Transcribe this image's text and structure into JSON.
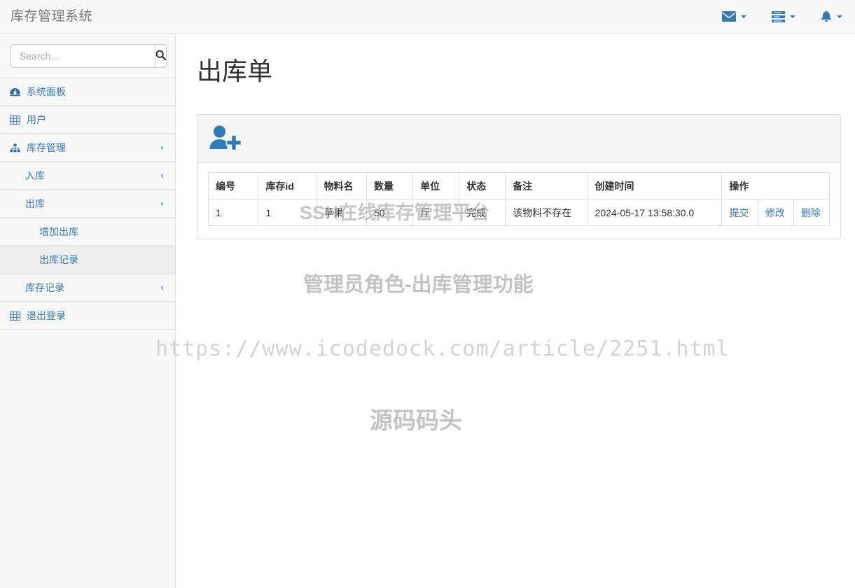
{
  "topbar": {
    "brand": "库存管理系统",
    "items": [
      {
        "icon": "envelope-icon",
        "name": "messages-dropdown"
      },
      {
        "icon": "tasks-icon",
        "name": "tasks-dropdown"
      },
      {
        "icon": "bell-icon",
        "name": "alerts-dropdown"
      }
    ],
    "accent_color": "#337ab7"
  },
  "sidebar": {
    "search": {
      "placeholder": "Search...",
      "value": "",
      "button_icon": "search-icon"
    },
    "items": [
      {
        "label": "系统面板",
        "icon": "dashboard-icon",
        "level": 1,
        "chevron": "",
        "active": false
      },
      {
        "label": "用户",
        "icon": "table-icon",
        "level": 1,
        "chevron": "",
        "active": false
      },
      {
        "label": "库存管理",
        "icon": "sitemap-icon",
        "level": 1,
        "chevron": "‹",
        "active": false
      },
      {
        "label": "入库",
        "icon": "",
        "level": 2,
        "chevron": "‹",
        "active": false
      },
      {
        "label": "出库",
        "icon": "",
        "level": 2,
        "chevron": "‹",
        "active": false
      },
      {
        "label": "增加出库",
        "icon": "",
        "level": 3,
        "chevron": "",
        "active": false
      },
      {
        "label": "出库记录",
        "icon": "",
        "level": 3,
        "chevron": "",
        "active": true
      },
      {
        "label": "库存记录",
        "icon": "",
        "level": 2,
        "chevron": "‹",
        "active": false
      },
      {
        "label": "退出登录",
        "icon": "table-icon",
        "level": 1,
        "chevron": "",
        "active": false
      }
    ]
  },
  "main": {
    "title": "出库单",
    "panel": {
      "add_button_icon": "user-plus-icon",
      "table": {
        "columns": [
          "编号",
          "库存id",
          "物料名",
          "数量",
          "单位",
          "状态",
          "备注",
          "创建时间",
          "操作"
        ],
        "rows": [
          {
            "编号": "1",
            "库存id": "1",
            "物料名": "苹果",
            "数量": "50",
            "单位": "斤",
            "状态": "完成",
            "备注": "该物料不存在",
            "创建时间": "2024-05-17 13:58:30.0",
            "操作": [
              "提交",
              "修改",
              "删除"
            ]
          }
        ]
      }
    }
  },
  "watermarks": {
    "table_overlay": "SSH在线库存管理平台",
    "role": "管理员角色-出库管理功能",
    "url": "https://www.icodedock.com/article/2251.html",
    "brand": "源码码头"
  }
}
